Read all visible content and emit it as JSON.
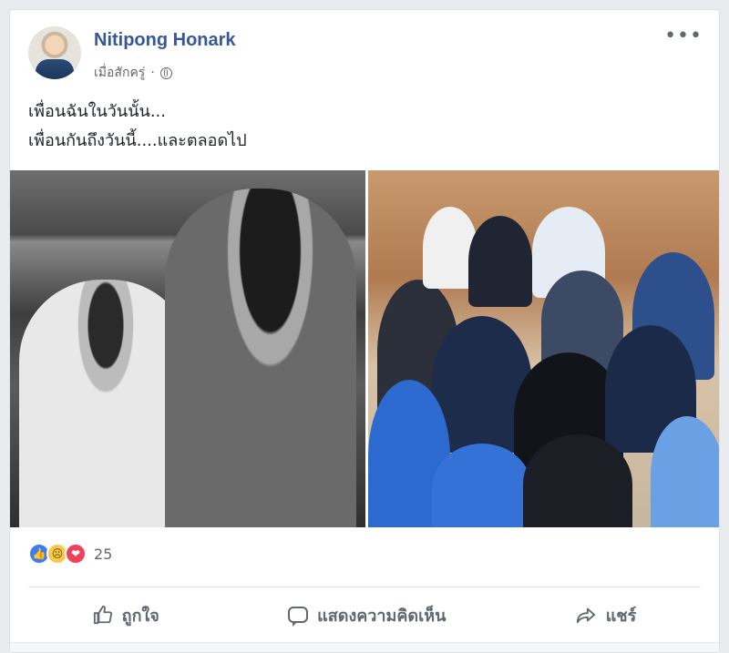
{
  "post": {
    "author": "Nitipong Honark",
    "timestamp": "เมื่อสักครู่",
    "separator": "·",
    "privacy_icon": "globe-icon",
    "more_icon": "more-options-icon",
    "more_label": "•••",
    "text_lines": [
      "เพื่อนฉันในวันนั้น...",
      "เพื่อนกันถึงวันนี้....และตลอดไป"
    ]
  },
  "reactions": {
    "icons": [
      "like-reaction-icon",
      "sad-reaction-icon",
      "love-reaction-icon"
    ],
    "count": "25"
  },
  "actions": {
    "like_label": "ถูกใจ",
    "comment_label": "แสดงความคิดเห็น",
    "share_label": "แชร์"
  },
  "colors": {
    "author_link": "#365899",
    "like_reaction": "#3b7df5",
    "love_reaction": "#f0405b",
    "sad_reaction": "#f7c84a",
    "secondary_text": "#616770"
  }
}
